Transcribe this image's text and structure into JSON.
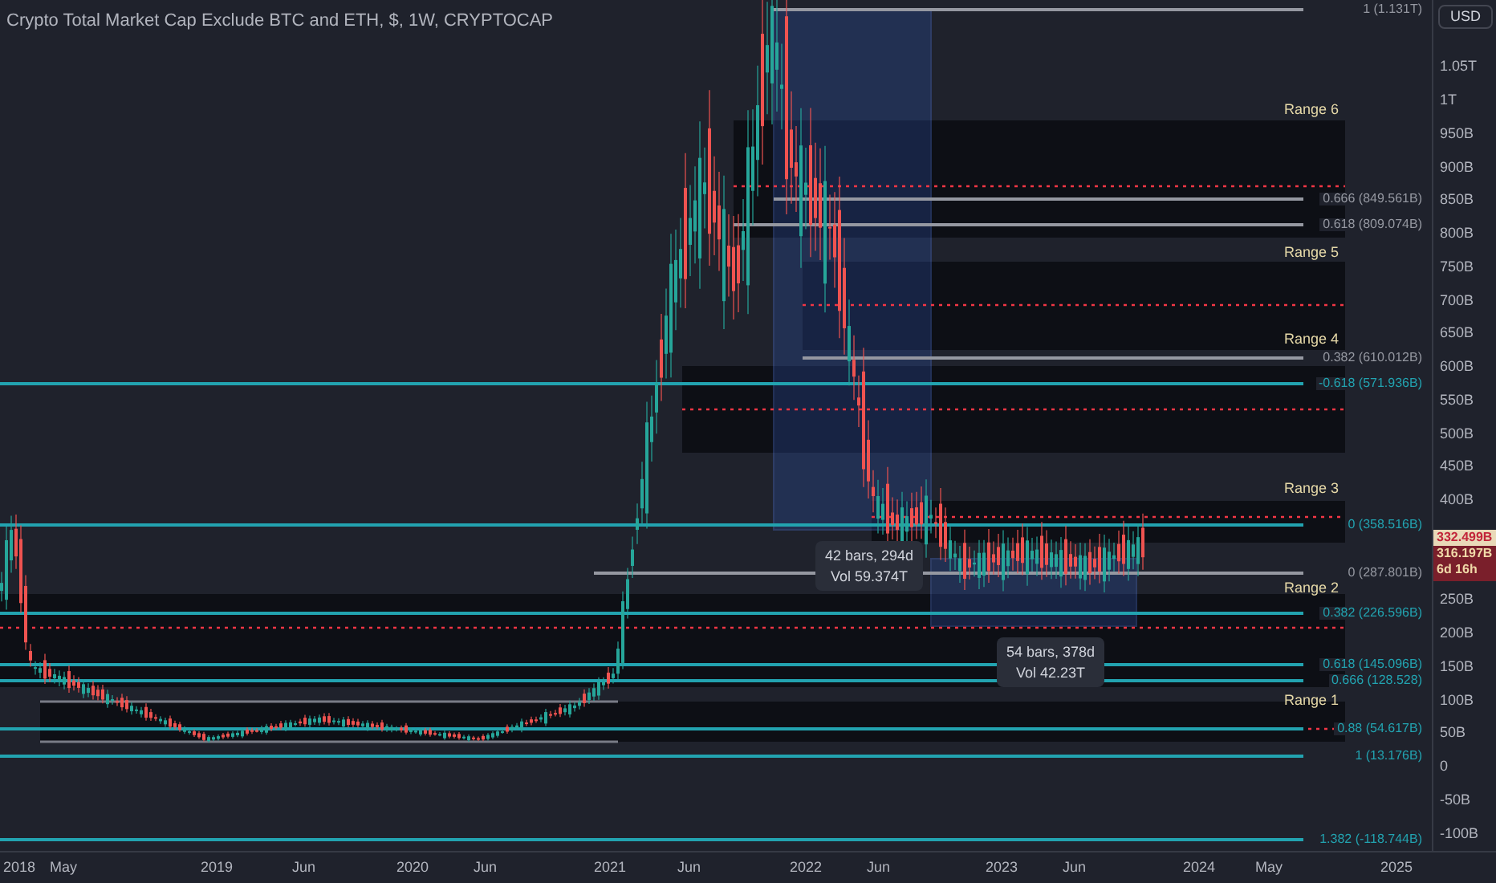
{
  "header": {
    "title": "Crypto Total Market Cap Exclude BTC and ETH, $, 1W, CRYPTOCAP"
  },
  "currency_button": "USD",
  "price_axis": [
    "1.05T",
    "1T",
    "950B",
    "900B",
    "850B",
    "800B",
    "750B",
    "700B",
    "650B",
    "600B",
    "550B",
    "500B",
    "450B",
    "400B",
    "250B",
    "200B",
    "150B",
    "100B",
    "50B",
    "0",
    "-50B",
    "-100B"
  ],
  "time_axis": [
    "2018",
    "May",
    "2019",
    "Jun",
    "2020",
    "Jun",
    "2021",
    "Jun",
    "2022",
    "Jun",
    "2023",
    "Jun",
    "2024",
    "May",
    "2025"
  ],
  "price_tag": {
    "last_price": "332.499B",
    "close_price": "316.197B",
    "countdown": "6d 16h"
  },
  "ranges": [
    {
      "label": "Range 6"
    },
    {
      "label": "Range 5"
    },
    {
      "label": "Range 4"
    },
    {
      "label": "Range 3"
    },
    {
      "label": "Range 2"
    },
    {
      "label": "Range 1"
    }
  ],
  "fib_levels": [
    {
      "label": "1 (1.131T)",
      "color": "#9598a1"
    },
    {
      "label": "0.666 (849.561B)",
      "color": "#9598a1"
    },
    {
      "label": "0.618 (809.074B)",
      "color": "#9598a1"
    },
    {
      "label": "0.382 (610.012B)",
      "color": "#9598a1"
    },
    {
      "label": "-0.618 (571.936B)",
      "color": "#22a3b0"
    },
    {
      "label": "0 (358.516B)",
      "color": "#22a3b0"
    },
    {
      "label": "0 (287.801B)",
      "color": "#9598a1"
    },
    {
      "label": "0.382 (226.596B)",
      "color": "#22a3b0"
    },
    {
      "label": "0.618 (145.096B)",
      "color": "#22a3b0"
    },
    {
      "label": "0.666 (128.528)",
      "color": "#22a3b0"
    },
    {
      "label": "0.88 (54.617B)",
      "color": "#22a3b0"
    },
    {
      "label": "1 (13.176B)",
      "color": "#22a3b0"
    },
    {
      "label": "1.382 (-118.744B)",
      "color": "#22a3b0"
    }
  ],
  "measures": [
    {
      "bars": "42 bars, 294d",
      "volume": "Vol 59.374T"
    },
    {
      "bars": "54 bars, 378d",
      "volume": "Vol 42.23T"
    }
  ]
}
